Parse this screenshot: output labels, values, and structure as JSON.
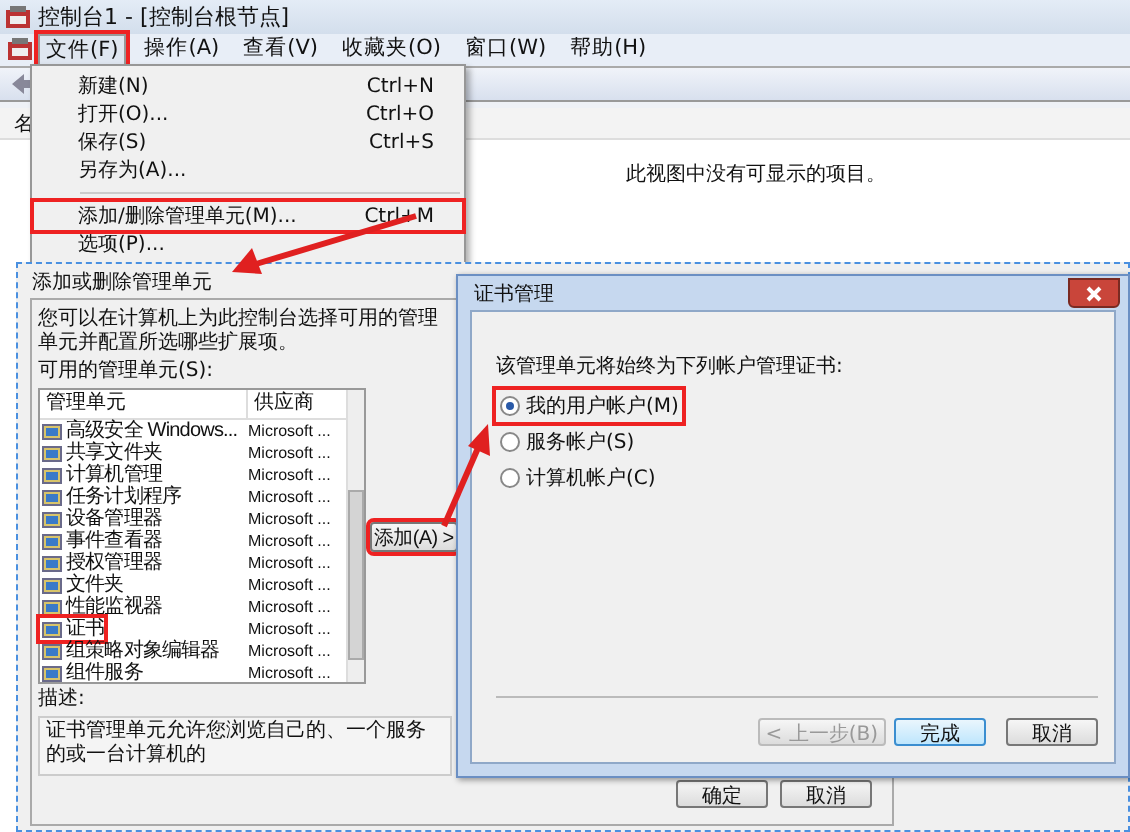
{
  "window": {
    "title": "控制台1 - [控制台根节点]"
  },
  "menu_bar": [
    {
      "label": "文件(F)",
      "selected": true,
      "annotated": true
    },
    {
      "label": "操作(A)",
      "selected": false,
      "annotated": false
    },
    {
      "label": "查看(V)",
      "selected": false,
      "annotated": false
    },
    {
      "label": "收藏夹(O)",
      "selected": false,
      "annotated": false
    },
    {
      "label": "窗口(W)",
      "selected": false,
      "annotated": false
    },
    {
      "label": "帮助(H)",
      "selected": false,
      "annotated": false
    }
  ],
  "view": {
    "column_1": "名",
    "empty_message": "此视图中没有可显示的项目。"
  },
  "file_menu": [
    {
      "kind": "item",
      "label": "新建(N)",
      "shortcut": "Ctrl+N",
      "annotated": false
    },
    {
      "kind": "item",
      "label": "打开(O)...",
      "shortcut": "Ctrl+O",
      "annotated": false
    },
    {
      "kind": "item",
      "label": "保存(S)",
      "shortcut": "Ctrl+S",
      "annotated": false
    },
    {
      "kind": "item",
      "label": "另存为(A)...",
      "annotated": false
    },
    {
      "kind": "separator"
    },
    {
      "kind": "item",
      "label": "添加/删除管理单元(M)...",
      "shortcut": "Ctrl+M",
      "annotated": true
    },
    {
      "kind": "item",
      "label": "选项(P)...",
      "annotated": false
    }
  ],
  "snapin_dialog": {
    "title": "添加或删除管理单元",
    "intro": "您可以在计算机上为此控制台选择可用的管理单元并配置所选哪些扩展项。",
    "available_label": "可用的管理单元(S):",
    "columns": [
      "管理单元",
      "供应商"
    ],
    "rows": [
      {
        "name": "高级安全 Windows...",
        "vendor": "Microsoft ...",
        "annotated": false
      },
      {
        "name": "共享文件夹",
        "vendor": "Microsoft ...",
        "annotated": false
      },
      {
        "name": "计算机管理",
        "vendor": "Microsoft ...",
        "annotated": false
      },
      {
        "name": "任务计划程序",
        "vendor": "Microsoft ...",
        "annotated": false
      },
      {
        "name": "设备管理器",
        "vendor": "Microsoft ...",
        "annotated": false
      },
      {
        "name": "事件查看器",
        "vendor": "Microsoft ...",
        "annotated": false
      },
      {
        "name": "授权管理器",
        "vendor": "Microsoft ...",
        "annotated": false
      },
      {
        "name": "文件夹",
        "vendor": "Microsoft ...",
        "annotated": false
      },
      {
        "name": "性能监视器",
        "vendor": "Microsoft ...",
        "annotated": false
      },
      {
        "name": "证书",
        "vendor": "Microsoft ...",
        "annotated": true
      },
      {
        "name": "组策略对象编辑器",
        "vendor": "Microsoft ...",
        "annotated": false
      },
      {
        "name": "组件服务",
        "vendor": "Microsoft ...",
        "annotated": false
      }
    ],
    "add_button": {
      "label": "添加(A) >",
      "annotated": true
    },
    "description_label": "描述:",
    "description": "证书管理单元允许您浏览自己的、一个服务的或一台计算机的",
    "buttons": [
      "确定",
      "取消"
    ]
  },
  "cert_dialog": {
    "title": "证书管理",
    "prompt": "该管理单元将始终为下列帐户管理证书:",
    "options": [
      {
        "label": "我的用户帐户(M)",
        "selected": true,
        "annotated": true
      },
      {
        "label": "服务帐户(S)",
        "selected": false,
        "annotated": false
      },
      {
        "label": "计算机帐户(C)",
        "selected": false,
        "annotated": false
      }
    ],
    "buttons": [
      {
        "label": "< 上一步(B)",
        "disabled": true,
        "default": false
      },
      {
        "label": "完成",
        "disabled": false,
        "default": true
      },
      {
        "label": "取消",
        "disabled": false,
        "default": false
      }
    ]
  }
}
